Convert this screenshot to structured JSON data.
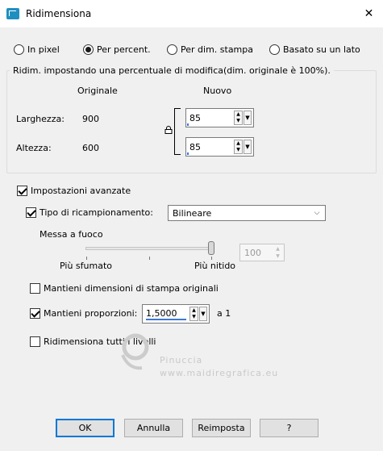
{
  "window": {
    "title": "Ridimensiona",
    "close_symbol": "✕",
    "icon": "resize-app-icon"
  },
  "mode": {
    "options": [
      "In pixel",
      "Per percent.",
      "Per dim. stampa",
      "Basato su un lato"
    ],
    "selected": "Per percent."
  },
  "group": {
    "legend": "Ridim. impostando una percentuale di modifica(dim. originale è 100%).",
    "col_original": "Originale",
    "col_new": "Nuovo",
    "width_label": "Larghezza:",
    "width_original": "900",
    "width_new": "85",
    "height_label": "Altezza:",
    "height_original": "600",
    "height_new": "85",
    "lock_icon": "lock-icon"
  },
  "advanced": {
    "label": "Impostazioni avanzate",
    "checked": true,
    "resample_label": "Tipo di ricampionamento:",
    "resample_checked": true,
    "resample_value": "Bilineare",
    "sharpen_label": "Messa a fuoco",
    "sharpen_min_label": "Più sfumato",
    "sharpen_max_label": "Più nitido",
    "sharpen_value": "100",
    "keep_print_label": "Mantieni dimensioni di stampa originali",
    "keep_print_checked": false,
    "keep_ratio_label": "Mantieni proporzioni:",
    "keep_ratio_checked": true,
    "ratio_value": "1,5000",
    "ratio_suffix": "a 1",
    "resize_all_label": "Ridimensiona tutti i livelli",
    "resize_all_checked": false
  },
  "watermark": {
    "line1": "Pinuccia",
    "line2": "www.maidiregrafica.eu"
  },
  "buttons": {
    "ok": "OK",
    "cancel": "Annulla",
    "reset": "Reimposta",
    "help": "?"
  },
  "colors": {
    "accent": "#0078d7",
    "window_bg": "#f0f0f0"
  }
}
